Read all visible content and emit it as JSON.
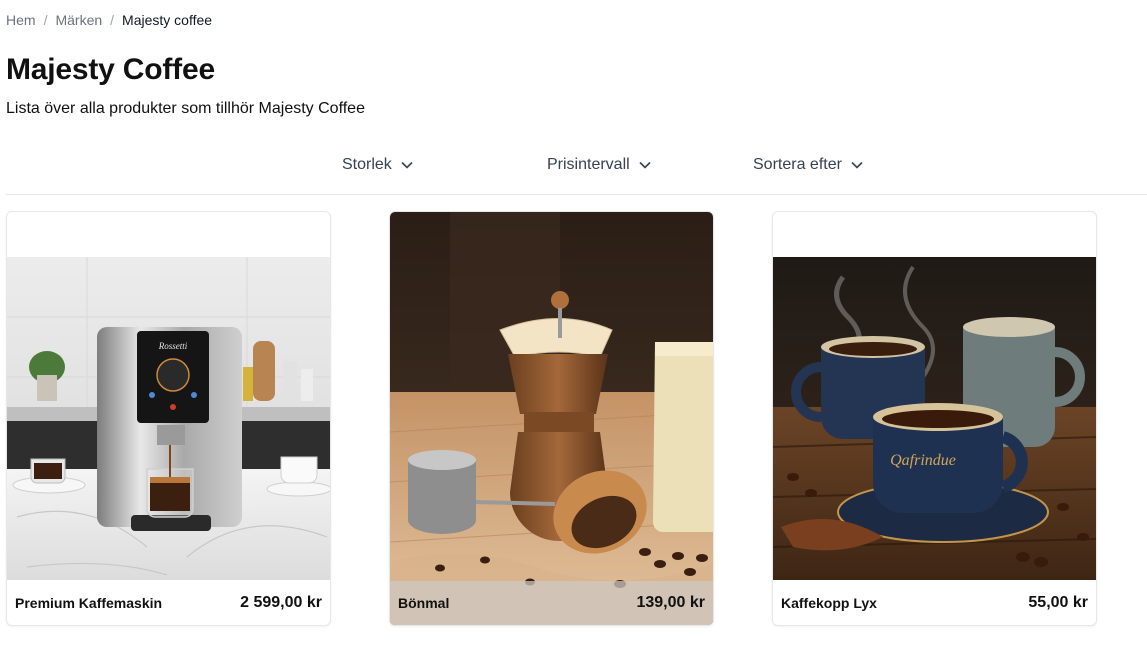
{
  "breadcrumb": {
    "home": "Hem",
    "brands": "Märken",
    "current": "Majesty coffee",
    "separator": "/"
  },
  "page": {
    "title": "Majesty Coffee",
    "subtitle": "Lista över alla produkter som tillhör Majesty Coffee"
  },
  "filters": [
    {
      "label": "Storlek",
      "icon": "chevron-down-icon"
    },
    {
      "label": "Prisintervall",
      "icon": "chevron-down-icon"
    },
    {
      "label": "Sortera efter",
      "icon": "chevron-down-icon"
    }
  ],
  "products": [
    {
      "name": "Premium Kaffemaskin",
      "price": "2 599,00 kr",
      "machine_brand": "Rossetti"
    },
    {
      "name": "Bönmal",
      "price": "139,00 kr"
    },
    {
      "name": "Kaffekopp Lyx",
      "price": "55,00 kr",
      "cup_text": "Qafrindue"
    }
  ]
}
